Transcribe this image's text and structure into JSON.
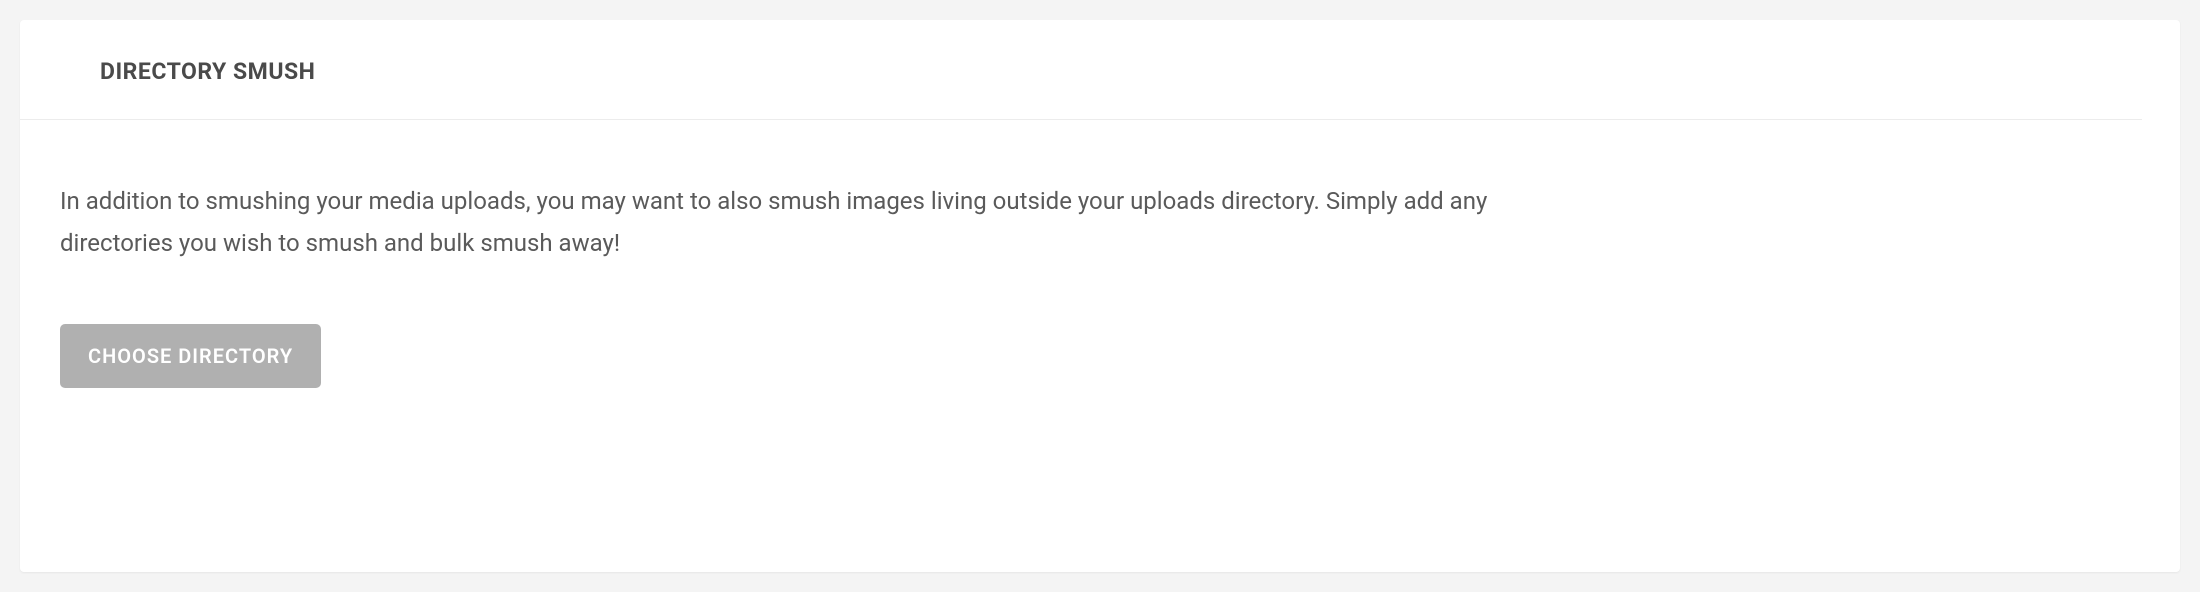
{
  "panel": {
    "title": "DIRECTORY SMUSH",
    "description": "In addition to smushing your media uploads, you may want to also smush images living outside your uploads directory. Simply add any directories you wish to smush and bulk smush away!",
    "button_label": "CHOOSE DIRECTORY"
  }
}
